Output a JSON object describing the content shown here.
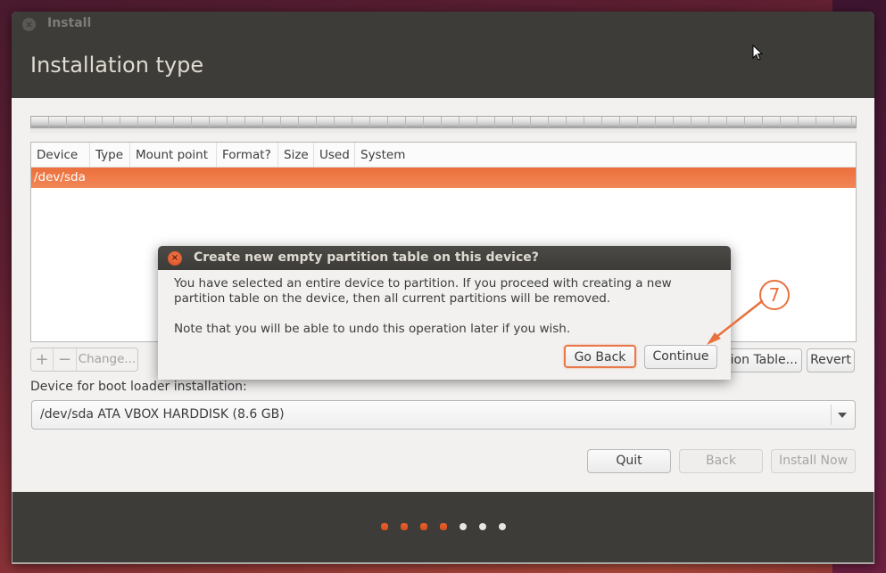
{
  "window": {
    "title": "Install",
    "close_icon": "close-icon"
  },
  "page": {
    "title": "Installation type"
  },
  "partition_table": {
    "columns": [
      "Device",
      "Type",
      "Mount point",
      "Format?",
      "Size",
      "Used",
      "System"
    ],
    "rows": [
      {
        "device": "/dev/sda",
        "type": "",
        "mount_point": "",
        "format": "",
        "size": "",
        "used": "",
        "system": "",
        "selected": true
      }
    ],
    "selection_color": "#ef7b49"
  },
  "toolbar": {
    "add_label": "+",
    "remove_label": "−",
    "change_label": "Change...",
    "new_table_label": "New Partition Table...",
    "new_table_visible_label": "tion Table...",
    "revert_label": "Revert"
  },
  "boot_loader": {
    "label": "Device for boot loader installation:",
    "selected": "/dev/sda  ATA VBOX HARDDISK (8.6 GB)"
  },
  "buttons": {
    "quit": "Quit",
    "back": "Back",
    "install_now": "Install Now"
  },
  "progress": {
    "total_steps": 7,
    "completed_steps": 4,
    "active_color": "#e95f2a",
    "inactive_color": "#e6e6e6"
  },
  "dialog": {
    "title": "Create new empty partition table on this device?",
    "message": "You have selected an entire device to partition. If you proceed with creating a new partition table on the device, then all current partitions will be removed.",
    "note": "Note that you will be able to undo this operation later if you wish.",
    "go_back_label": "Go Back",
    "continue_label": "Continue"
  },
  "annotation": {
    "step_number": "7",
    "color": "#e9713c",
    "points_to": "Continue"
  }
}
